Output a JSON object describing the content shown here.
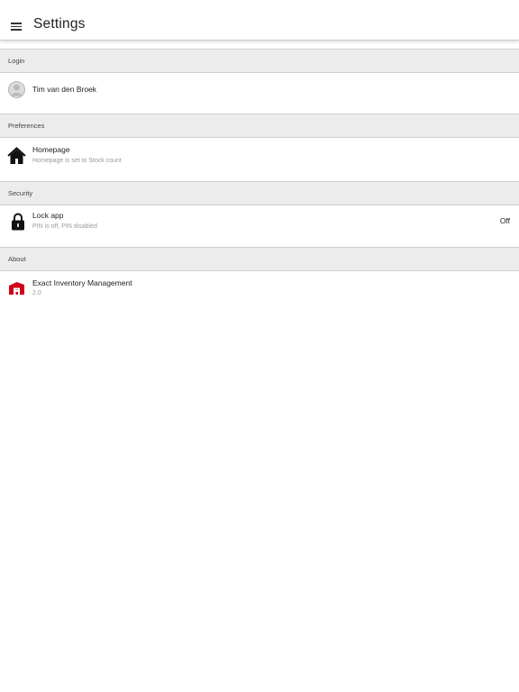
{
  "header": {
    "title": "Settings",
    "menu_icon": "hamburger-menu-icon"
  },
  "sections": {
    "login": {
      "title": "Login",
      "user_name": "Tim van den Broek",
      "icon": "avatar-icon"
    },
    "preferences": {
      "title": "Preferences",
      "homepage_title": "Homepage",
      "homepage_sub": "Homepage is set to Stock count",
      "icon": "home-icon"
    },
    "security": {
      "title": "Security",
      "lock_title": "Lock app",
      "lock_sub": "PIN is off, PIN disabled",
      "lock_value": "Off",
      "icon": "lock-icon"
    },
    "about": {
      "title": "About",
      "app_name": "Exact Inventory Management",
      "version": "2.0",
      "icon": "exact-logo-icon"
    }
  },
  "colors": {
    "brand": "#d0021b",
    "section_bg": "#ececec",
    "text": "#222222",
    "muted": "#9a9a9a"
  }
}
